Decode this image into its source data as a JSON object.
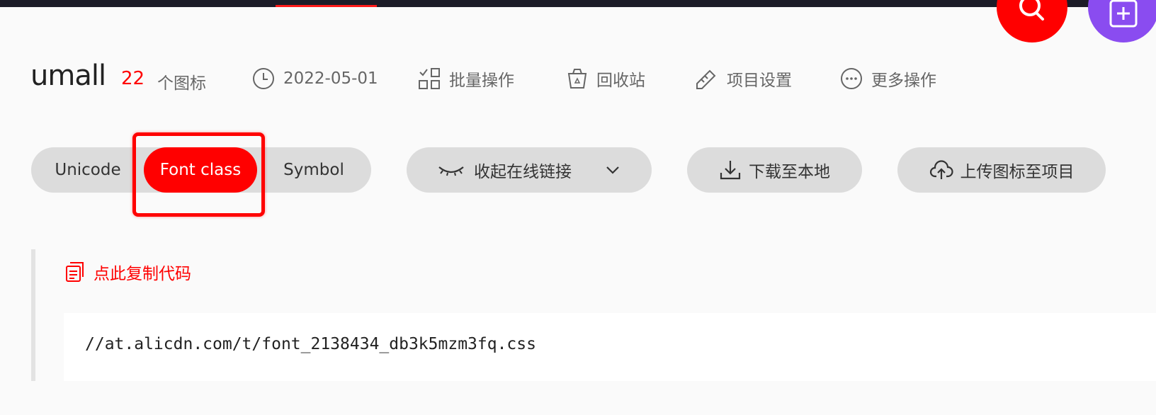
{
  "project": {
    "name": "umall",
    "icon_count": "22",
    "icon_count_label": "个图标"
  },
  "meta": {
    "date": "2022-05-01",
    "batch": "批量操作",
    "recycle": "回收站",
    "settings": "项目设置",
    "more": "更多操作"
  },
  "segments": {
    "unicode": "Unicode",
    "font_class": "Font class",
    "symbol": "Symbol",
    "active": "font_class"
  },
  "actions": {
    "collapse_link": "收起在线链接",
    "download": "下载至本地",
    "upload": "上传图标至项目"
  },
  "code": {
    "copy_label": "点此复制代码",
    "url": "//at.alicdn.com/t/font_2138434_db3k5mzm3fq.css"
  },
  "colors": {
    "accent": "#ff0000",
    "add_button": "#8a4cf0",
    "topbar": "#1c1c28"
  },
  "icons": {
    "search": "search-icon",
    "add": "plus-square-icon",
    "date": "clock-icon",
    "batch": "grid-check-icon",
    "recycle": "trash-icon",
    "settings": "pencil-icon",
    "more": "more-dots-icon",
    "collapse": "eye-closed-icon",
    "dropdown": "chevron-down-icon",
    "download": "download-icon",
    "upload": "cloud-upload-icon",
    "copy": "copy-icon"
  }
}
